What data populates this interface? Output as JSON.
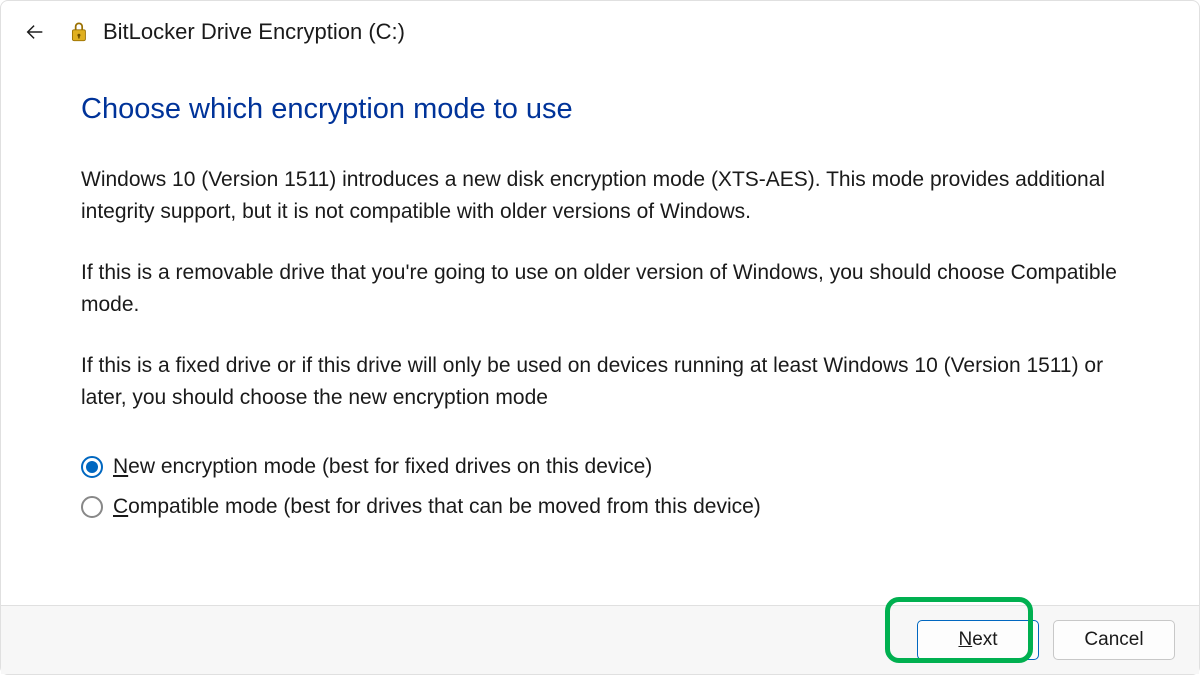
{
  "header": {
    "title": "BitLocker Drive Encryption (C:)"
  },
  "main": {
    "heading": "Choose which encryption mode to use",
    "paragraphs": [
      "Windows 10 (Version 1511) introduces a new disk encryption mode (XTS-AES). This mode provides additional integrity support, but it is not compatible with older versions of Windows.",
      "If this is a removable drive that you're going to use on older version of Windows, you should choose Compatible mode.",
      "If this is a fixed drive or if this drive will only be used on devices running at least Windows 10 (Version 1511) or later, you should choose the new encryption mode"
    ],
    "options": [
      {
        "label_pre": "N",
        "label_rest": "ew encryption mode (best for fixed drives on this device)",
        "selected": true
      },
      {
        "label_pre": "C",
        "label_rest": "ompatible mode (best for drives that can be moved from this device)",
        "selected": false
      }
    ]
  },
  "footer": {
    "next_pre": "N",
    "next_rest": "ext",
    "cancel": "Cancel"
  },
  "colors": {
    "heading": "#003399",
    "accent": "#0067c0",
    "highlight": "#00b050"
  }
}
